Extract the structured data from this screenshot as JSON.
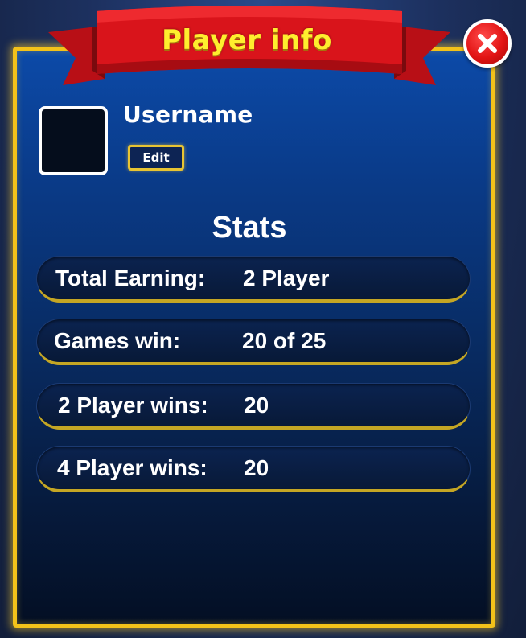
{
  "header": {
    "title": "Player info"
  },
  "profile": {
    "username": "Username",
    "edit_label": "Edit"
  },
  "stats": {
    "title": "Stats",
    "rows": [
      {
        "label": "Total Earning:",
        "value": "2 Player"
      },
      {
        "label": "Games win:",
        "value": "20 of 25"
      },
      {
        "label": "2 Player wins:",
        "value": "20"
      },
      {
        "label": "4 Player wins:",
        "value": "20"
      }
    ]
  },
  "icons": {
    "close": "close-icon"
  },
  "colors": {
    "panel_border": "#f3c21a",
    "ribbon": "#d9141b",
    "title_text": "#ffee2e",
    "close_button": "#e21414"
  }
}
